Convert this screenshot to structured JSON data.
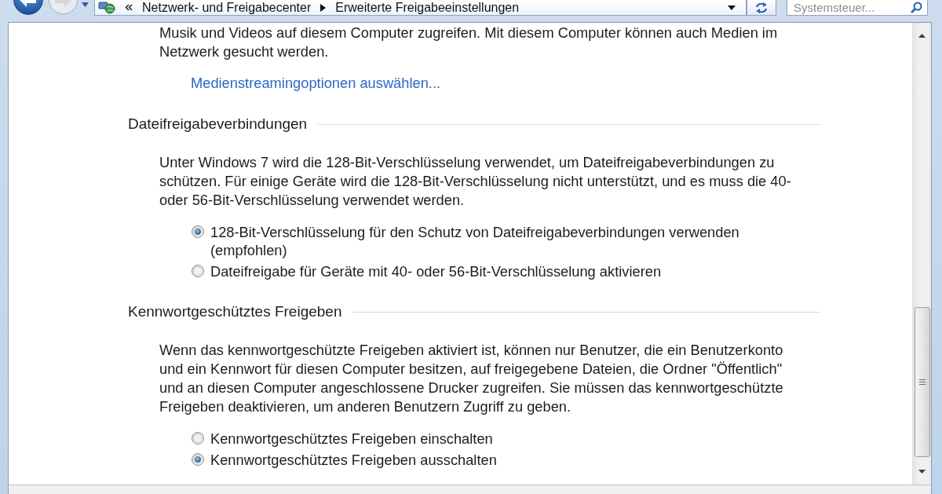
{
  "navigation": {
    "breadcrumb": [
      {
        "label": "Netzwerk- und Freigabecenter"
      },
      {
        "label": "Erweiterte Freigabeeinstellungen"
      }
    ],
    "search": {
      "placeholder": "Systemsteuer..."
    }
  },
  "content": {
    "intro": "Musik und Videos auf diesem Computer zugreifen. Mit diesem Computer können auch Medien im Netzwerk gesucht werden.",
    "link": "Medienstreamingoptionen auswählen...",
    "sections": [
      {
        "title": "Dateifreigabeverbindungen",
        "description": "Unter Windows 7 wird die 128-Bit-Verschlüsselung verwendet, um Dateifreigabeverbindungen zu schützen. Für einige Geräte wird die 128-Bit-Verschlüsselung nicht unterstützt, und es muss die 40- oder 56-Bit-Verschlüsselung verwendet werden.",
        "options": [
          {
            "label": "128-Bit-Verschlüsselung für den Schutz von Dateifreigabeverbindungen verwenden (empfohlen)",
            "selected": true
          },
          {
            "label": "Dateifreigabe für Geräte mit 40- oder 56-Bit-Verschlüsselung aktivieren",
            "selected": false
          }
        ]
      },
      {
        "title": "Kennwortgeschütztes Freigeben",
        "description": "Wenn das kennwortgeschützte Freigeben aktiviert ist, können nur Benutzer, die ein Benutzerkonto und ein Kennwort für diesen Computer besitzen, auf freigegebene Dateien, die Ordner \"Öffentlich\" und an diesen Computer angeschlossene Drucker zugreifen. Sie müssen das kennwortgeschützte Freigeben deaktivieren, um anderen Benutzern Zugriff zu geben.",
        "options": [
          {
            "label": "Kennwortgeschütztes Freigeben einschalten",
            "selected": false
          },
          {
            "label": "Kennwortgeschütztes Freigeben ausschalten",
            "selected": true
          }
        ]
      }
    ]
  }
}
